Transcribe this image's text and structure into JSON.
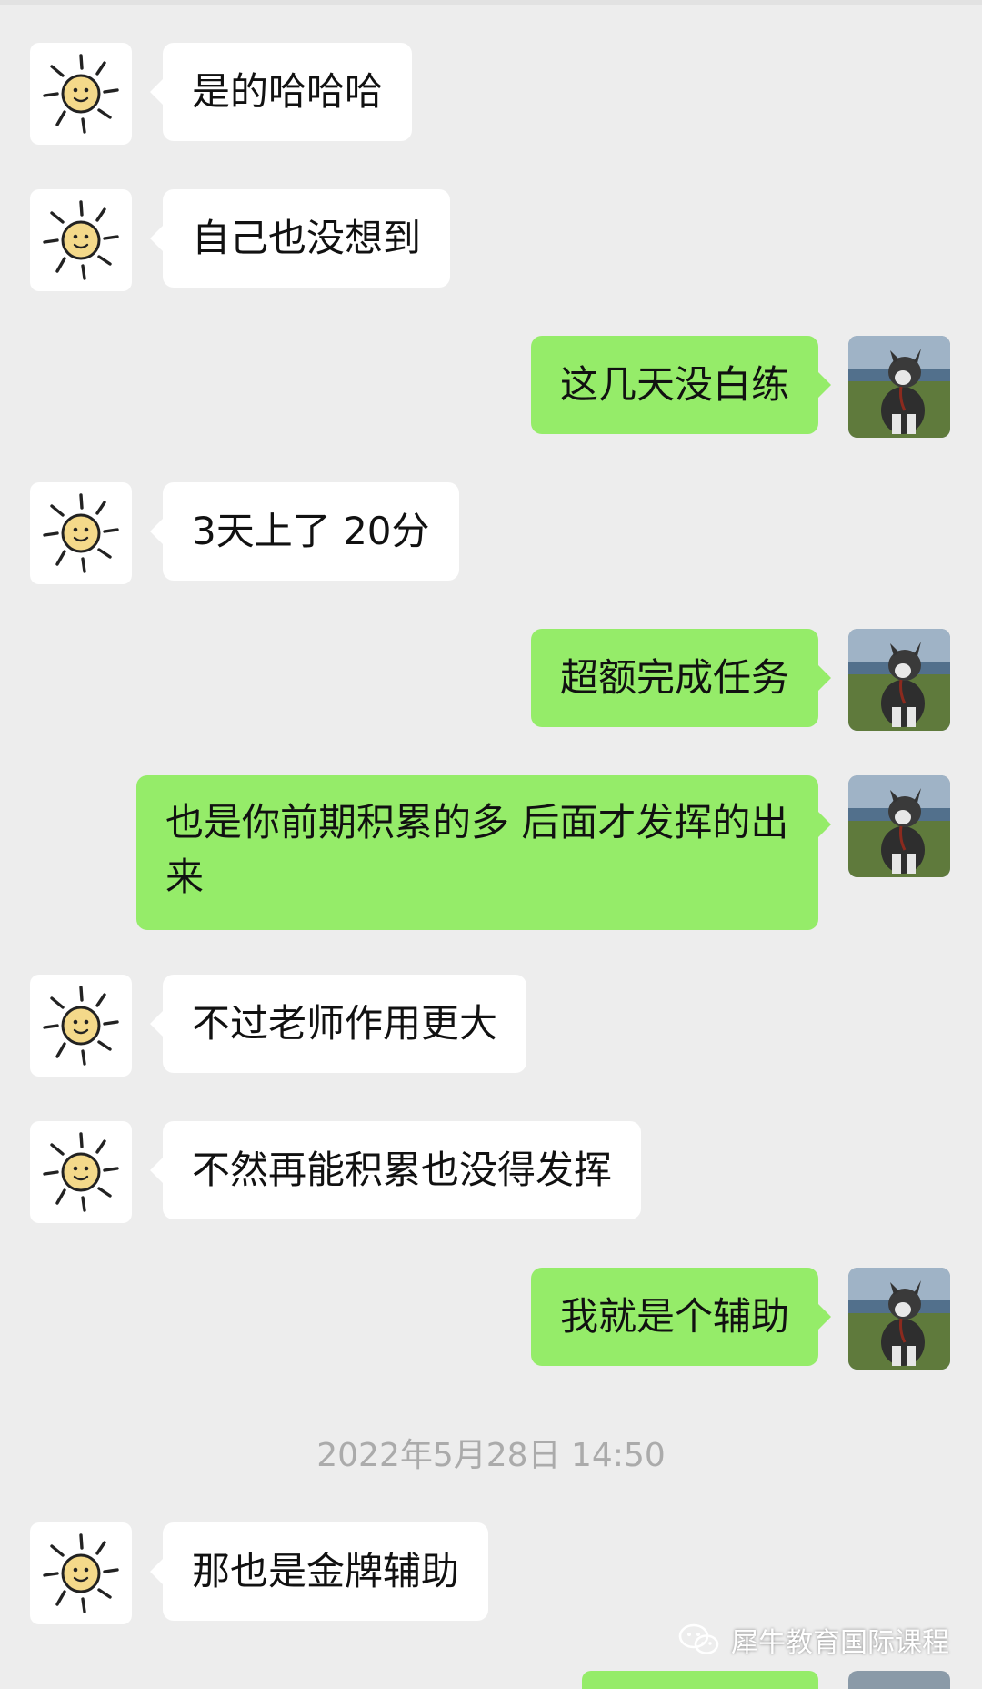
{
  "messages": [
    {
      "side": "in",
      "text": "是的哈哈哈"
    },
    {
      "side": "in",
      "text": "自己也没想到"
    },
    {
      "side": "out",
      "text": "这几天没白练"
    },
    {
      "side": "in",
      "text": "3天上了 20分"
    },
    {
      "side": "out",
      "text": "超额完成任务"
    },
    {
      "side": "out",
      "text": "也是你前期积累的多 后面才发挥的出来"
    },
    {
      "side": "in",
      "text": "不过老师作用更大"
    },
    {
      "side": "in",
      "text": "不然再能积累也没得发挥"
    },
    {
      "side": "out",
      "text": "我就是个辅助"
    },
    {
      "side": "in",
      "text": "那也是金牌辅助"
    }
  ],
  "timestamp": "2022年5月28日 14:50",
  "watermark": "犀牛教育国际课程",
  "colors": {
    "background": "#ededed",
    "incoming_bubble": "#ffffff",
    "outgoing_bubble": "#95ec69",
    "timestamp_text": "#ababab"
  },
  "icons": {
    "incoming_avatar": "sun-avatar-icon",
    "outgoing_avatar": "dog-avatar-icon",
    "watermark_logo": "wechat-logo-icon"
  }
}
